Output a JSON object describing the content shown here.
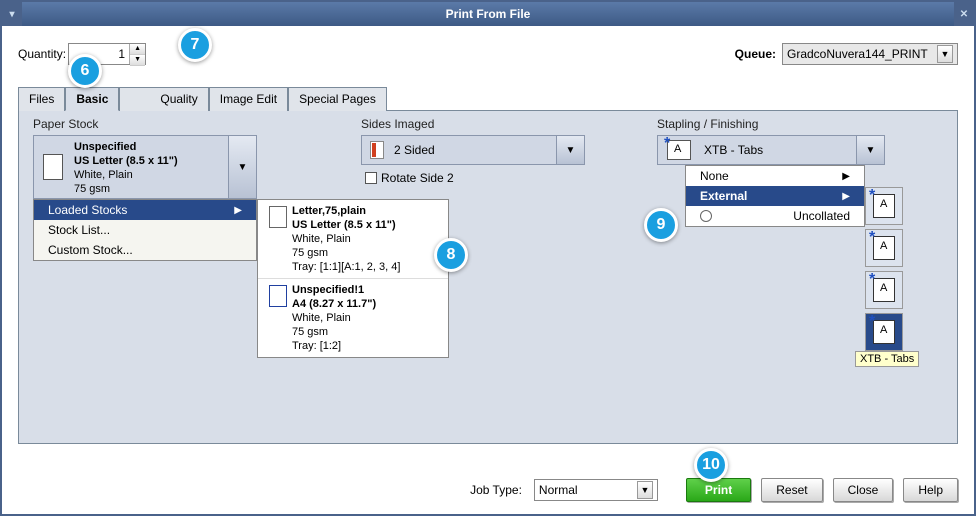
{
  "title": "Print From File",
  "toprow": {
    "quantity_label": "Quantity:",
    "quantity_value": "1",
    "queue_label": "Queue:",
    "queue_value": "GradcoNuvera144_PRINT"
  },
  "tabs": [
    "Files",
    "Basic",
    "Quality",
    "Image Edit",
    "Special Pages"
  ],
  "paper_stock": {
    "label": "Paper Stock",
    "current": {
      "line1": "Unspecified",
      "line2": "US Letter (8.5 x 11\")",
      "line3": "White, Plain",
      "line4": "75 gsm"
    },
    "menu": [
      "Loaded Stocks",
      "Stock List...",
      "Custom Stock..."
    ],
    "submenu": [
      {
        "l1": "Letter,75,plain",
        "l2": "US Letter (8.5 x 11\")",
        "l3": "White, Plain",
        "l4": "75 gsm",
        "l5": "Tray: [1:1][A:1, 2, 3, 4]"
      },
      {
        "l1": "Unspecified!1",
        "l2": "A4 (8.27 x 11.7\")",
        "l3": "White, Plain",
        "l4": "75 gsm",
        "l5": "Tray: [1:2]"
      }
    ]
  },
  "sides": {
    "label": "Sides Imaged",
    "value": "2 Sided",
    "rotate_label": "Rotate Side 2"
  },
  "stapling": {
    "label": "Stapling / Finishing",
    "value": "XTB - Tabs",
    "menu": [
      "None",
      "External",
      "Uncollated"
    ],
    "tooltip": "XTB - Tabs"
  },
  "bottom": {
    "jobtype_label": "Job Type:",
    "jobtype_value": "Normal",
    "print": "Print",
    "reset": "Reset",
    "close": "Close",
    "help": "Help"
  },
  "callouts": {
    "c6": "6",
    "c7": "7",
    "c8": "8",
    "c9": "9",
    "c10": "10"
  }
}
